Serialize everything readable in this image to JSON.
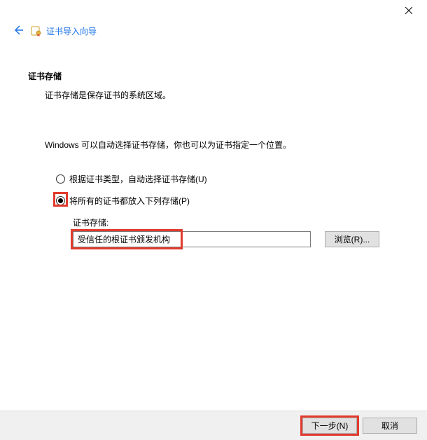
{
  "window": {
    "wizard_title": "证书导入向导"
  },
  "content": {
    "heading": "证书存储",
    "desc": "证书存储是保存证书的系统区域。",
    "instruction": "Windows 可以自动选择证书存储，你也可以为证书指定一个位置。",
    "radio_auto": "根据证书类型，自动选择证书存储(U)",
    "radio_manual": "将所有的证书都放入下列存储(P)",
    "store_label": "证书存储:",
    "store_value": "受信任的根证书颁发机构",
    "browse": "浏览(R)..."
  },
  "footer": {
    "next": "下一步(N)",
    "cancel": "取消"
  }
}
